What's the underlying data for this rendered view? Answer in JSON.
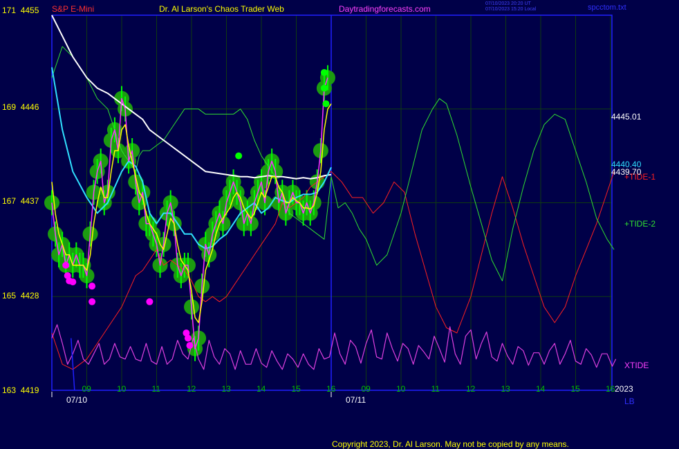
{
  "header": {
    "symbol": "S&P E-Mini",
    "title": "Dr. Al Larson's Chaos Trader Web",
    "site": "Daytradingforecasts.com",
    "timestamp_utc": "07/10/2023 20:20 UT",
    "timestamp_local": "07/10/2023 15:20 Local",
    "file": "spcctom.txt"
  },
  "footer": {
    "copyright": "Copyright 2023, Dr. Al Larson. May not be copied by any means."
  },
  "labels": {
    "year": "2023",
    "lb": "LB"
  },
  "colors": {
    "background": "#000048",
    "grid": "#103c10",
    "frame": "#2020ff",
    "price": "#00ff00",
    "price_glow": "#1c9c10",
    "short_ma": "#ffff00",
    "smooth": "#ff30ff",
    "cyan_ma": "#30e0ff",
    "white_ma": "#ffffff",
    "tide1": "#ff2020",
    "tide2": "#30e030",
    "xtide": "#e040e0",
    "dots": "#ff00ff"
  },
  "chart_data": {
    "type": "line",
    "y_left_ticks": [
      {
        "cycle": "171",
        "price": "4455",
        "value": 4455
      },
      {
        "cycle": "169",
        "price": "4446",
        "value": 4446
      },
      {
        "cycle": "167",
        "price": "4437",
        "value": 4437
      },
      {
        "cycle": "165",
        "price": "4428",
        "value": 4428
      },
      {
        "cycle": "163",
        "price": "4419",
        "value": 4419
      }
    ],
    "ylim": [
      4419,
      4455
    ],
    "x_hour_labels": [
      {
        "label": "09",
        "t": 1.0
      },
      {
        "label": "10",
        "t": 2.0
      },
      {
        "label": "11",
        "t": 3.0
      },
      {
        "label": "12",
        "t": 4.0
      },
      {
        "label": "13",
        "t": 5.0
      },
      {
        "label": "14",
        "t": 6.0
      },
      {
        "label": "15",
        "t": 7.0
      },
      {
        "label": "16",
        "t": 8.0
      },
      {
        "label": "09",
        "t": 9.0
      },
      {
        "label": "10",
        "t": 10.0
      },
      {
        "label": "11",
        "t": 11.0
      },
      {
        "label": "12",
        "t": 12.0
      },
      {
        "label": "13",
        "t": 13.0
      },
      {
        "label": "14",
        "t": 14.0
      },
      {
        "label": "15",
        "t": 15.0
      },
      {
        "label": "16",
        "t": 16.0
      }
    ],
    "x_date_labels": [
      {
        "label": "07/10",
        "t": 0.0
      },
      {
        "label": "07/11",
        "t": 8.0
      }
    ],
    "xlim": [
      0,
      16.2
    ],
    "right_labels": {
      "price_last": "4445.01",
      "cyan_last": "4440.40",
      "white_last": "4439.70",
      "tide1": "+TIDE-1",
      "tide2": "+TIDE-2",
      "xtide": "XTIDE"
    },
    "series": [
      {
        "key": "price",
        "x": [
          0.0,
          0.1,
          0.2,
          0.3,
          0.4,
          0.5,
          0.6,
          0.7,
          0.8,
          0.9,
          1.0,
          1.1,
          1.2,
          1.3,
          1.4,
          1.5,
          1.6,
          1.7,
          1.8,
          1.9,
          2.0,
          2.1,
          2.2,
          2.3,
          2.4,
          2.5,
          2.6,
          2.7,
          2.8,
          2.9,
          3.0,
          3.1,
          3.2,
          3.3,
          3.4,
          3.5,
          3.6,
          3.7,
          3.8,
          3.9,
          4.0,
          4.1,
          4.2,
          4.3,
          4.4,
          4.5,
          4.6,
          4.7,
          4.8,
          4.9,
          5.0,
          5.1,
          5.2,
          5.3,
          5.4,
          5.5,
          5.6,
          5.7,
          5.8,
          5.9,
          6.0,
          6.1,
          6.2,
          6.3,
          6.4,
          6.5,
          6.6,
          6.7,
          6.8,
          6.9,
          7.0,
          7.1,
          7.2,
          7.3,
          7.4,
          7.5,
          7.6,
          7.7,
          7.8,
          7.9
        ],
        "y": [
          4437,
          4434,
          4432,
          4433,
          4431,
          4432,
          4431,
          4432,
          4431,
          4431,
          4430,
          4434,
          4438,
          4440,
          4441,
          4437,
          4438,
          4443,
          4444,
          4442,
          4447,
          4446,
          4441,
          4442,
          4439,
          4437,
          4438,
          4435,
          4435,
          4434,
          4433,
          4431,
          4433,
          4436,
          4437,
          4435,
          4431,
          4430,
          4431,
          4431,
          4427,
          4423,
          4424,
          4429,
          4433,
          4432,
          4434,
          4435,
          4436,
          4435,
          4437,
          4438,
          4439,
          4438,
          4437,
          4435,
          4436,
          4435,
          4437,
          4438,
          4439,
          4437,
          4440,
          4441,
          4440,
          4437,
          4438,
          4436,
          4437,
          4438,
          4437,
          4437,
          4436,
          4437,
          4436,
          4437,
          4439,
          4442,
          4448,
          4449
        ]
      },
      {
        "key": "short_ma",
        "x": [
          0.0,
          0.1,
          0.2,
          0.3,
          0.4,
          0.5,
          0.6,
          0.7,
          0.8,
          0.9,
          1.0,
          1.1,
          1.2,
          1.3,
          1.4,
          1.5,
          1.6,
          1.7,
          1.8,
          1.9,
          2.0,
          2.1,
          2.2,
          2.3,
          2.4,
          2.5,
          2.6,
          2.7,
          2.8,
          2.9,
          3.0,
          3.1,
          3.2,
          3.3,
          3.4,
          3.5,
          3.6,
          3.7,
          3.8,
          3.9,
          4.0,
          4.1,
          4.2,
          4.3,
          4.4,
          4.5,
          4.6,
          4.7,
          4.8,
          4.9,
          5.0,
          5.1,
          5.2,
          5.3,
          5.4,
          5.5,
          5.6,
          5.7,
          5.8,
          5.9,
          6.0,
          6.1,
          6.2,
          6.3,
          6.4,
          6.5,
          6.6,
          6.7,
          6.8,
          6.9,
          7.0,
          7.1,
          7.2,
          7.3,
          7.4,
          7.5,
          7.6,
          7.7,
          7.8,
          7.9,
          8.0
        ],
        "y": [
          4439,
          4436,
          4434,
          4433,
          4432,
          4432,
          4431,
          4431,
          4431,
          4431,
          4430.5,
          4432,
          4435,
          4437,
          4438.5,
          4437.5,
          4437.5,
          4440,
          4442,
          4442,
          4444,
          4444.5,
          4442.5,
          4441,
          4439.5,
          4438,
          4437.5,
          4436,
          4435,
          4434.5,
          4434,
          4433,
          4432.5,
          4434,
          4435.5,
          4435,
          4433,
          4431.5,
          4431,
          4430.5,
          4428.5,
          4426,
          4425.5,
          4427.5,
          4430.5,
          4431.5,
          4432.5,
          4434,
          4435,
          4435.5,
          4436,
          4436.5,
          4437.5,
          4438,
          4437.5,
          4436.5,
          4436,
          4435.5,
          4436,
          4437,
          4438,
          4437.5,
          4438.5,
          4439.5,
          4439.5,
          4438.5,
          4438,
          4437,
          4437,
          4437.5,
          4437.2,
          4437,
          4436.5,
          4436.5,
          4436.4,
          4436.7,
          4438,
          4440,
          4444,
          4446,
          4446.5
        ]
      },
      {
        "key": "cyan_ma",
        "x": [
          0.0,
          0.3,
          0.6,
          1.0,
          1.3,
          1.6,
          1.8,
          2.0,
          2.2,
          2.4,
          2.6,
          2.8,
          3.0,
          3.2,
          3.4,
          3.6,
          3.8,
          4.0,
          4.2,
          4.4,
          4.6,
          4.8,
          5.0,
          5.2,
          5.4,
          5.6,
          5.8,
          6.0,
          6.2,
          6.4,
          6.6,
          6.8,
          7.0,
          7.2,
          7.4,
          7.6,
          7.8,
          8.0
        ],
        "y": [
          4450,
          4444,
          4440,
          4437.5,
          4436,
          4437,
          4438.5,
          4440,
          4441,
          4440.5,
          4439,
          4436,
          4435,
          4436,
          4436,
          4435,
          4434,
          4434,
          4433,
          4432.6,
          4432.8,
          4433.5,
          4434,
          4435,
          4436,
          4436.5,
          4437,
          4436,
          4436.5,
          4437.5,
          4437.2,
          4437,
          4437.5,
          4437.8,
          4437.8,
          4438,
          4439,
          4440.4
        ]
      },
      {
        "key": "white_ma",
        "x": [
          0.0,
          0.3,
          0.6,
          1.0,
          1.3,
          1.6,
          1.8,
          2.0,
          2.2,
          2.4,
          2.6,
          2.8,
          3.0,
          3.2,
          3.4,
          3.6,
          3.8,
          4.0,
          4.2,
          4.4,
          4.6,
          4.8,
          5.0,
          5.2,
          5.4,
          5.6,
          5.8,
          6.0,
          6.2,
          6.4,
          6.6,
          6.8,
          7.0,
          7.2,
          7.4,
          7.6,
          7.8,
          8.0
        ],
        "y": [
          4455,
          4453,
          4451,
          4449,
          4448,
          4447.5,
          4447,
          4446.5,
          4446,
          4445.5,
          4445,
          4444,
          4443.5,
          4443,
          4442.5,
          4442,
          4441.5,
          4441,
          4440.5,
          4440,
          4439.9,
          4439.8,
          4439.7,
          4439.6,
          4439.5,
          4439.5,
          4439.4,
          4439.5,
          4439.6,
          4439.5,
          4439.5,
          4439.4,
          4439.3,
          4439.4,
          4439.3,
          4439.4,
          4439.6,
          4439.7
        ]
      },
      {
        "key": "tide2",
        "x": [
          0.0,
          0.3,
          0.6,
          1.0,
          1.3,
          1.6,
          1.8,
          2.0,
          2.2,
          2.4,
          2.5,
          2.6,
          2.8,
          3.0,
          3.2,
          3.4,
          3.6,
          3.8,
          4.0,
          4.2,
          4.4,
          4.6,
          4.8,
          5.0,
          5.2,
          5.4,
          5.6,
          5.8,
          6.0,
          6.2,
          6.4,
          6.6,
          6.8,
          7.0,
          7.2,
          7.4,
          7.6,
          7.8,
          8.0,
          8.2,
          8.4,
          8.6,
          8.8,
          9.0,
          9.3,
          9.6,
          10.0,
          10.3,
          10.6,
          10.9,
          11.1,
          11.3,
          11.6,
          12.0,
          12.3,
          12.6,
          12.9,
          13.2,
          13.5,
          13.8,
          14.1,
          14.4,
          14.7,
          15.0,
          15.3,
          15.6,
          15.9,
          16.1
        ],
        "y": [
          4449,
          4452,
          4451,
          4449,
          4447,
          4446,
          4444,
          4442,
          4441,
          4440,
          4441.5,
          4442,
          4442,
          4442.5,
          4443,
          4444,
          4445,
          4446,
          4446,
          4446,
          4445.5,
          4445.5,
          4445.5,
          4445.5,
          4445.5,
          4446,
          4445,
          4443,
          4441.5,
          4440.5,
          4439.5,
          4437.5,
          4436,
          4435.5,
          4435,
          4434.5,
          4434,
          4433.5,
          4439.5,
          4436.5,
          4437,
          4436,
          4434.5,
          4433.5,
          4431,
          4432,
          4436,
          4440,
          4444,
          4446,
          4447,
          4446.5,
          4443.5,
          4438.5,
          4435,
          4431.5,
          4429.5,
          4434.5,
          4438.5,
          4442,
          4444.5,
          4445.5,
          4445,
          4442,
          4439,
          4435.5,
          4433.5,
          4432.5
        ]
      },
      {
        "key": "tide1",
        "x": [
          0.0,
          0.3,
          0.6,
          1.0,
          1.3,
          1.6,
          1.8,
          2.0,
          2.2,
          2.4,
          2.6,
          2.8,
          3.0,
          3.2,
          3.4,
          3.6,
          3.8,
          4.0,
          4.2,
          4.4,
          4.6,
          4.8,
          5.0,
          5.2,
          5.4,
          5.6,
          5.8,
          6.0,
          6.2,
          6.4,
          6.6,
          6.8,
          7.0,
          7.2,
          7.4,
          7.6,
          7.8,
          8.0,
          8.3,
          8.6,
          8.9,
          9.2,
          9.5,
          9.8,
          10.1,
          10.4,
          10.7,
          11.0,
          11.3,
          11.6,
          12.0,
          12.3,
          12.6,
          12.9,
          13.2,
          13.5,
          13.8,
          14.1,
          14.4,
          14.7,
          15.0,
          15.3,
          15.6,
          15.9,
          16.1
        ],
        "y": [
          4424.5,
          4421.5,
          4421,
          4422,
          4423.5,
          4425,
          4426,
          4427,
          4428.5,
          4430,
          4430.5,
          4431.5,
          4432.5,
          4431,
          4431.5,
          4431,
          4430.5,
          4429.5,
          4428,
          4427.5,
          4428,
          4427.5,
          4428,
          4429,
          4430,
          4431,
          4432,
          4433,
          4434,
          4435,
          4437,
          4436.5,
          4437,
          4437.5,
          4438.5,
          4439,
          4439.5,
          4440,
          4439,
          4437.5,
          4437.5,
          4436,
          4437,
          4439,
          4438,
          4434,
          4430.5,
          4427,
          4425,
          4424.5,
          4428,
          4432,
          4436,
          4439.5,
          4436.5,
          4433,
          4430,
          4427,
          4425.5,
          4427,
          4430,
          4432.5,
          4435,
          4438,
          4440
        ]
      },
      {
        "key": "xtide",
        "x": [
          0.0,
          0.15,
          0.3,
          0.45,
          0.6,
          0.75,
          0.9,
          1.05,
          1.2,
          1.35,
          1.5,
          1.65,
          1.8,
          1.95,
          2.1,
          2.25,
          2.4,
          2.55,
          2.7,
          2.85,
          3.0,
          3.15,
          3.3,
          3.45,
          3.6,
          3.75,
          3.9,
          4.05,
          4.2,
          4.35,
          4.5,
          4.65,
          4.8,
          4.95,
          5.1,
          5.25,
          5.4,
          5.55,
          5.7,
          5.85,
          6.0,
          6.15,
          6.3,
          6.45,
          6.6,
          6.75,
          6.9,
          7.05,
          7.2,
          7.35,
          7.5,
          7.65,
          7.8,
          7.95,
          8.1,
          8.25,
          8.4,
          8.55,
          8.7,
          8.85,
          9.0,
          9.15,
          9.3,
          9.45,
          9.6,
          9.75,
          9.9,
          10.05,
          10.2,
          10.35,
          10.5,
          10.65,
          10.8,
          10.95,
          11.1,
          11.25,
          11.4,
          11.55,
          11.7,
          11.85,
          12.0,
          12.15,
          12.3,
          12.45,
          12.6,
          12.75,
          12.9,
          13.05,
          13.2,
          13.35,
          13.5,
          13.65,
          13.8,
          13.95,
          14.1,
          14.25,
          14.4,
          14.55,
          14.7,
          14.85,
          15.0,
          15.15,
          15.3,
          15.45,
          15.6,
          15.75,
          15.9,
          16.05,
          16.15
        ],
        "y": [
          4424,
          4425.3,
          4423.5,
          4421.5,
          4422.5,
          4423.8,
          4422,
          4421.5,
          4422.5,
          4423.5,
          4421.5,
          4422,
          4423.5,
          4422.2,
          4422,
          4423.2,
          4422,
          4421.8,
          4423.5,
          4421.8,
          4421.5,
          4423.2,
          4421.5,
          4422,
          4423.8,
          4422.5,
          4422,
          4424,
          4422,
          4421,
          4423.8,
          4422.2,
          4421.5,
          4423,
          4422.5,
          4421,
          4422.8,
          4421.5,
          4421.5,
          4423,
          4421.6,
          4421.2,
          4422.8,
          4421.8,
          4421,
          4422.5,
          4422,
          4421.2,
          4422.5,
          4421.5,
          4421,
          4423,
          4422,
          4422.2,
          4424.5,
          4422.5,
          4421.5,
          4423.8,
          4423.2,
          4421.6,
          4423.5,
          4424.8,
          4422.2,
          4422,
          4424.5,
          4423,
          4421.8,
          4423.5,
          4423,
          4421.5,
          4423.3,
          4422.7,
          4422,
          4424.2,
          4423,
          4421.7,
          4425.1,
          4422.5,
          4421.5,
          4424.2,
          4424.8,
          4422,
          4423.5,
          4424.6,
          4422.2,
          4421.8,
          4423.5,
          4422.3,
          4421.5,
          4423.2,
          4422.8,
          4421.4,
          4422.6,
          4422.6,
          4421.5,
          4422.8,
          4423.5,
          4421.5,
          4422.5,
          4423.8,
          4421.8,
          4421.5,
          4423,
          4422.4,
          4421.2,
          4422.5,
          4422.5,
          4421.3,
          4422
        ]
      },
      {
        "key": "dots",
        "x": [
          0.4,
          0.45,
          0.5,
          0.6,
          1.15,
          1.15,
          2.8,
          3.85,
          3.9,
          3.95
        ],
        "y": [
          4431,
          4430,
          4429.5,
          4429.4,
          4429,
          4427.5,
          4427.5,
          4424.5,
          4424,
          4423.3
        ]
      },
      {
        "key": "green_dots",
        "x": [
          5.35,
          7.8,
          7.8,
          7.85
        ],
        "y": [
          4441.5,
          4449.5,
          4448,
          4446.5
        ]
      }
    ]
  }
}
